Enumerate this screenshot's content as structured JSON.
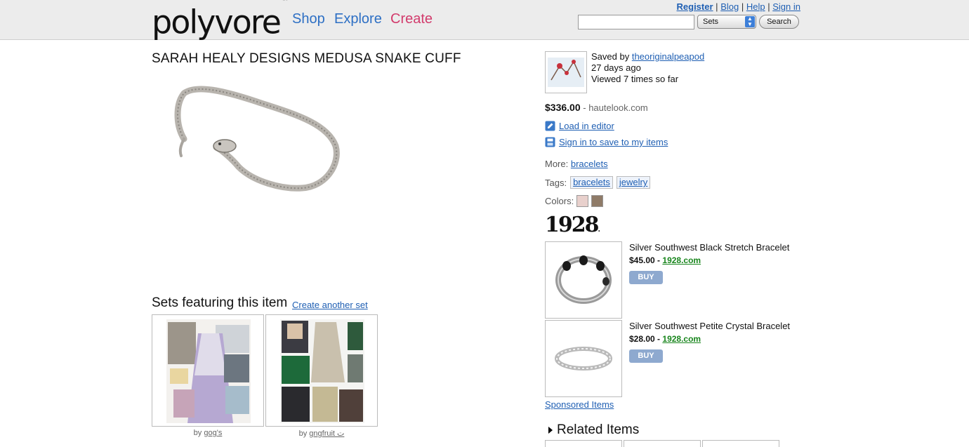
{
  "header": {
    "logo": "polyvore",
    "logo_tm": "™",
    "nav": {
      "shop": "Shop",
      "explore": "Explore",
      "create": "Create"
    },
    "links": {
      "register": "Register",
      "blog": "Blog",
      "help": "Help",
      "sign_in": "Sign in",
      "sep": "|"
    },
    "search": {
      "value": "",
      "select_value": "Sets",
      "button": "Search"
    },
    "colors": {
      "nav": "#2d6fc4",
      "create": "#d23b6c"
    }
  },
  "item": {
    "title": "SARAH HEALY DESIGNS MEDUSA SNAKE CUFF",
    "image": "snake-cuff-bracelet"
  },
  "sets": {
    "heading": "Sets featuring this item",
    "create_link": "Create another set",
    "by_prefix": "by",
    "list": [
      {
        "author": "gog's"
      },
      {
        "author": "gngfruit ت"
      }
    ]
  },
  "saved": {
    "prefix": "Saved by",
    "user": "theoriginalpeapod",
    "when": "27 days ago",
    "views": "Viewed 7 times so far"
  },
  "price": {
    "amount": "$336.00",
    "sep": "-",
    "source": "hautelook.com"
  },
  "actions": {
    "load_editor": "Load in editor",
    "save": "Sign in to save to my items"
  },
  "more": {
    "label": "More:",
    "link": "bracelets"
  },
  "tags": {
    "label": "Tags:",
    "items": [
      "bracelets",
      "jewelry"
    ]
  },
  "colors": {
    "label": "Colors:",
    "swatches": [
      "#e8d0cc",
      "#8f7b68"
    ]
  },
  "brand": {
    "name": "1928",
    "dot": "."
  },
  "products": [
    {
      "name": "Silver Southwest Black Stretch Bracelet",
      "price": "$45.00",
      "sep": "-",
      "store": "1928.com",
      "buy": "BUY"
    },
    {
      "name": "Silver Southwest Petite Crystal Bracelet",
      "price": "$28.00",
      "sep": "-",
      "store": "1928.com",
      "buy": "BUY"
    }
  ],
  "sponsored": "Sponsored Items",
  "related": "Related Items"
}
